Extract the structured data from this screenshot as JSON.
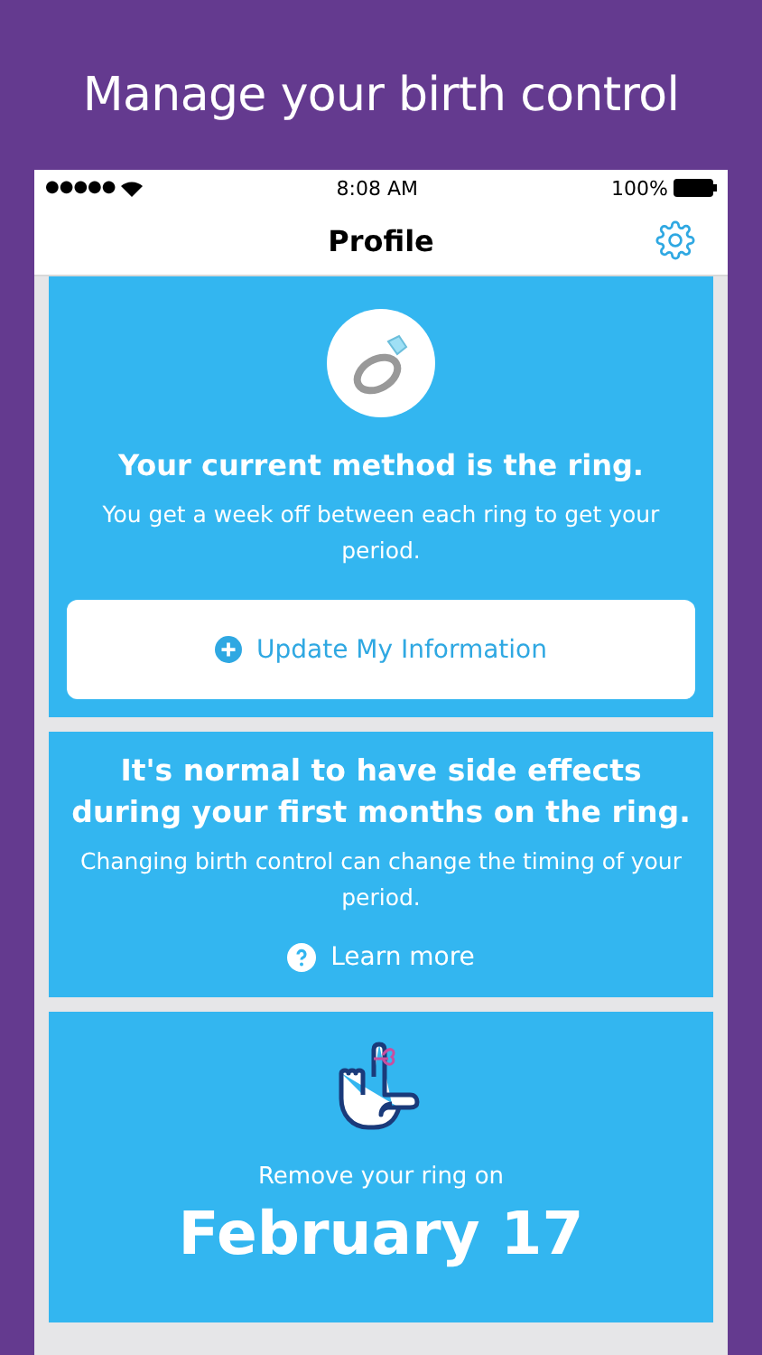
{
  "headline": "Manage your birth control",
  "status_bar": {
    "signal": "●●●●●",
    "time": "8:08 AM",
    "battery": "100%"
  },
  "nav": {
    "title": "Profile"
  },
  "cards": [
    {
      "kind": "method",
      "title": "Your current method is the ring.",
      "body": "You get a week off between each ring to get your period.",
      "button": "Update My Information"
    },
    {
      "kind": "info",
      "title": "It's normal to have side effects during your first months on the ring.",
      "body": "Changing birth control can change the timing of your period.",
      "link": "Learn more"
    },
    {
      "kind": "reminder",
      "label": "Remove your ring on",
      "date": "February 17"
    }
  ]
}
